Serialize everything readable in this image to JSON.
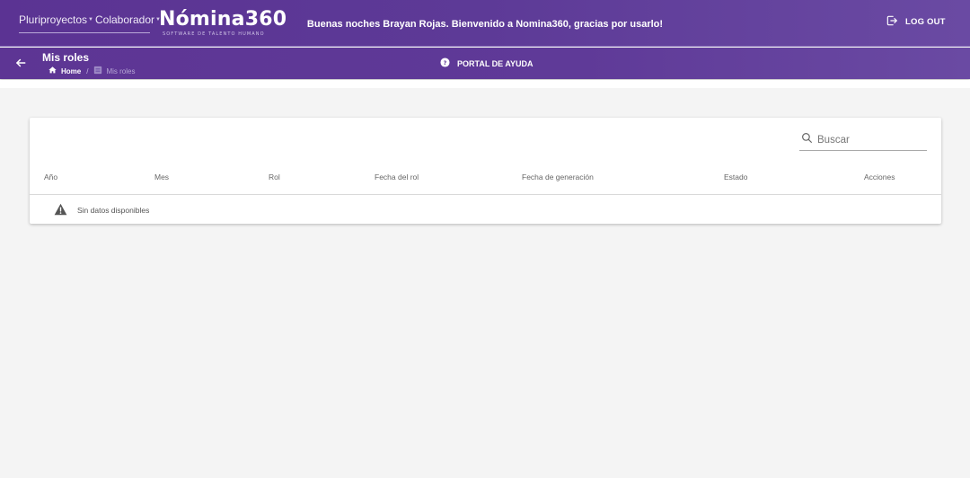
{
  "header": {
    "company_selector": "Pluriproyectos",
    "role_selector": "Colaborador",
    "logo_name": "Nómina360",
    "logo_tagline": "SOFTWARE DE TALENTO HUMANO",
    "welcome": "Buenas noches Brayan Rojas. Bienvenido a Nomina360, gracias por usarlo!",
    "logout_label": "LOG OUT"
  },
  "subheader": {
    "title": "Mis roles",
    "breadcrumb_home": "Home",
    "breadcrumb_current": "Mis roles",
    "help_label": "PORTAL DE AYUDA"
  },
  "table": {
    "search_placeholder": "Buscar",
    "columns": [
      "Año",
      "Mes",
      "Rol",
      "Fecha del rol",
      "Fecha de generación",
      "Estado",
      "Acciones"
    ],
    "empty_message": "Sin datos disponibles"
  },
  "colors": {
    "brand_purple": "#5d3594",
    "background": "#f4f4f4"
  }
}
